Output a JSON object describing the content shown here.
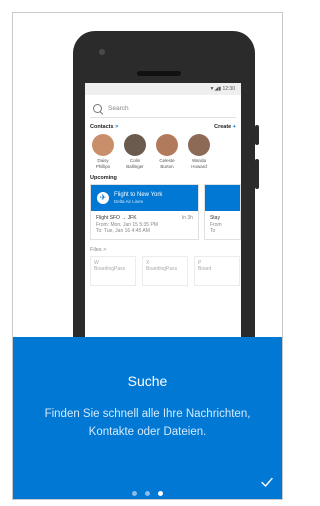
{
  "phone": {
    "status_time": "12:30",
    "search_placeholder": "Search",
    "contacts_label": "Contacts",
    "contacts_arrow": ">",
    "create_label": "Create",
    "create_plus": "+",
    "contacts": [
      {
        "first": "Daisy",
        "last": "Phillips",
        "color": "#c98f6b"
      },
      {
        "first": "Colin",
        "last": "Ballinger",
        "color": "#6b5a4e"
      },
      {
        "first": "Celeste",
        "last": "Burton",
        "color": "#b27a5c"
      },
      {
        "first": "Wanda",
        "last": "Howard",
        "color": "#8d6a55"
      }
    ],
    "upcoming_label": "Upcoming",
    "flight": {
      "title": "Flight to New York",
      "airline": "Delta Air Lines",
      "route": "Flight SFO → JFK",
      "duration": "In 3h",
      "from": "From: Mon, Jan 15 5:35 PM",
      "to": "To: Tue, Jan 16 4:45 AM"
    },
    "stay": {
      "title": "Stay",
      "from": "From",
      "to": "To"
    },
    "files_label": "Files >",
    "files": [
      {
        "letter": "W",
        "name": "BoardingPass"
      },
      {
        "letter": "X",
        "name": "BoardingPass"
      },
      {
        "letter": "P",
        "name": "Board"
      }
    ]
  },
  "panel": {
    "title": "Suche",
    "description": "Finden Sie schnell alle Ihre Nachrichten, Kontakte oder Dateien.",
    "accent_color": "#0078d4"
  }
}
